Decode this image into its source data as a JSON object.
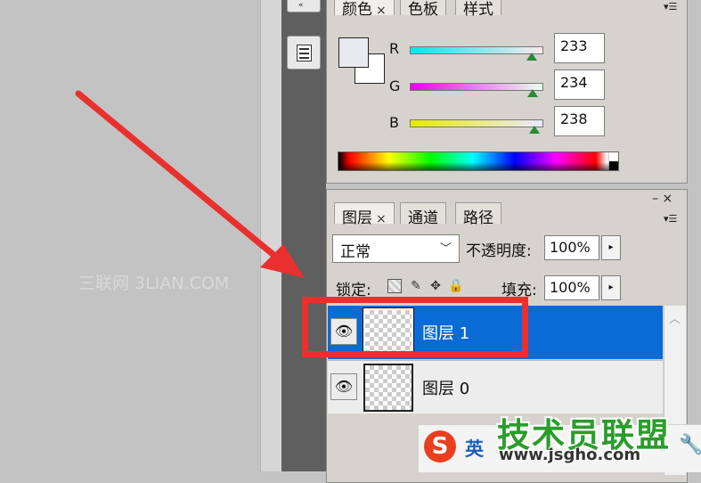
{
  "watermark_left": "三联网 3LIAN.COM",
  "color_panel": {
    "tabs": [
      "颜色",
      "色板",
      "样式"
    ],
    "close_glyph": "×",
    "menu_glyph": "▾☰",
    "channels": [
      {
        "label": "R",
        "value": "233",
        "fraction": 0.914
      },
      {
        "label": "G",
        "value": "234",
        "fraction": 0.918
      },
      {
        "label": "B",
        "value": "238",
        "fraction": 0.933
      }
    ],
    "foreground_color": "#e9eaee",
    "background_color": "#ffffff"
  },
  "layers_panel": {
    "tabs": [
      "图层",
      "通道",
      "路径"
    ],
    "close_glyph": "×",
    "pin_glyphs": "– ×",
    "menu_glyph": "▾☰",
    "blend_mode": "正常",
    "opacity_label": "不透明度:",
    "opacity_value": "100%",
    "lock_label": "锁定:",
    "fill_label": "填充:",
    "fill_value": "100%",
    "stepper_glyph": "▸",
    "layers": [
      {
        "name": "图层 1",
        "selected": true,
        "visible_glyph": "👁"
      },
      {
        "name": "图层 0",
        "selected": false,
        "visible_glyph": "👁"
      }
    ],
    "scroll_up_glyph": "︿"
  },
  "ime": {
    "logo": "S",
    "language": "英",
    "up_glyph": "⇧",
    "wrench_glyph": "🔧"
  },
  "watermark_brand": "技术员联盟",
  "watermark_url": "www.jsgho.com",
  "colors": {
    "highlight": "#e8302f",
    "selection": "#0a6ad6",
    "arrow": "#e8302f"
  }
}
